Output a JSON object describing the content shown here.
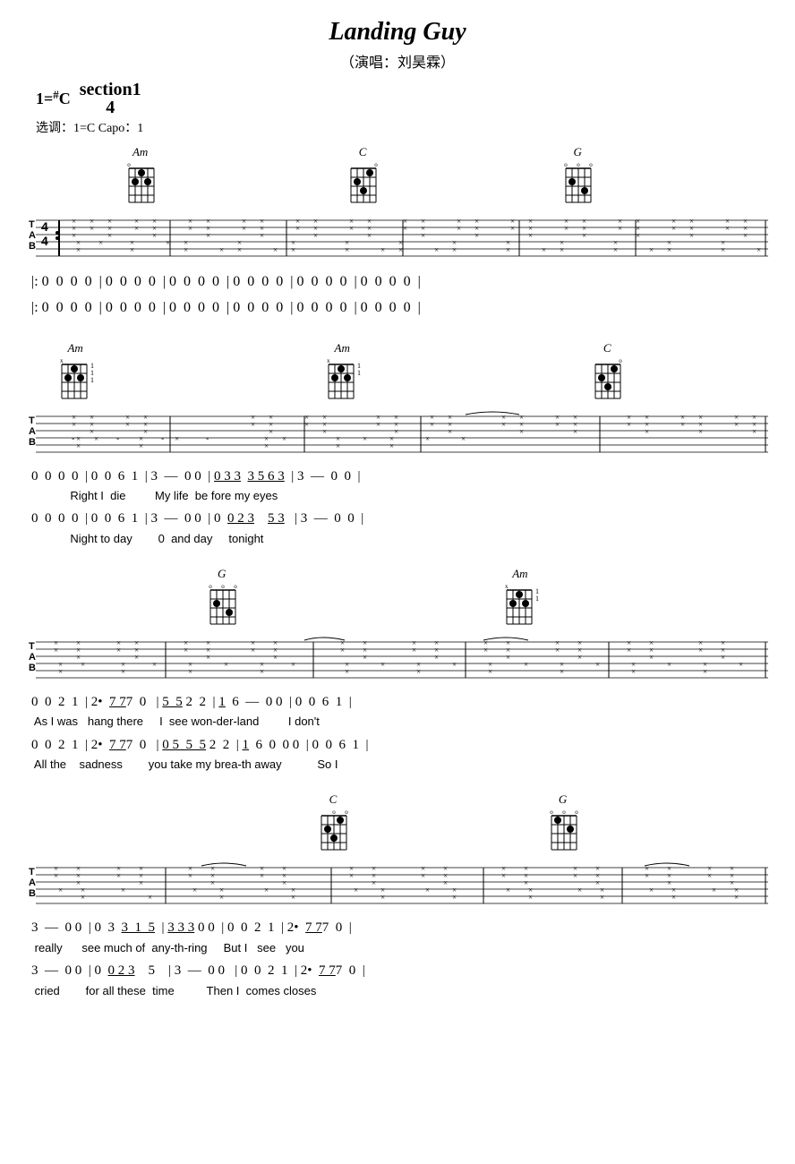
{
  "title": "Landing Guy",
  "subtitle": "（演唱：刘昊霖）",
  "key_display": "1=",
  "key_sharp": "#",
  "key_note": "C",
  "time_num": "4",
  "time_den": "4",
  "capo_line": "选调：1=C  Capo：1",
  "sections": [
    {
      "id": "section1",
      "chords": [
        {
          "name": "Am",
          "x_pct": 17,
          "fret": ""
        },
        {
          "name": "C",
          "x_pct": 47,
          "fret": ""
        },
        {
          "name": "G",
          "x_pct": 76,
          "fret": ""
        }
      ],
      "notes_lines": [
        "|: 0  0  0  0  | 0  0  0  0  | 0  0  0  0  | 0  0  0  0  | 0  0  0  0  | 0  0  0  0  |",
        "|: 0  0  0  0  | 0  0  0  0  | 0  0  0  0  | 0  0  0  0  | 0  0  0  0  | 0  0  0  0  |"
      ],
      "lyrics_lines": [
        "",
        ""
      ]
    },
    {
      "id": "section2",
      "chords": [
        {
          "name": "Am",
          "x_pct": 8,
          "fret": "x"
        },
        {
          "name": "Am",
          "x_pct": 43,
          "fret": "x"
        },
        {
          "name": "C",
          "x_pct": 79,
          "fret": ""
        }
      ],
      "notes_lines": [
        "0  0  0  0  | 0  0  6  1  | 3  —  0  0  | 0̲3̲3   3̲ 5̲ 6̲3̲  | 3  —  0  0  |",
        "0  0  0  0  | 0  0  6  1  | 3  —  0  0  | 0  0̲2̲3    5̲3̲   | 3  —  0  0  |"
      ],
      "lyrics_lines": [
        "            Right I  die          My life  be fore my eyes",
        "            Night to day         0  and day     tonight"
      ]
    },
    {
      "id": "section3",
      "chords": [
        {
          "name": "G",
          "x_pct": 28,
          "fret": ""
        },
        {
          "name": "Am",
          "x_pct": 68,
          "fret": "x"
        }
      ],
      "notes_lines": [
        "0  0  2  1  | 2•  7̲7̲7̲ 0   | 5̲  5̲ 2  2  | 1̲  6  —  0  0  | 0  0  6  1  |",
        "0  0  2  1  | 2•  7̲7̲7̲ 0   | 0̲5̲ 5̲ 5̲ 2  2  | 1̲  6  0  0  0  | 0  0  6  1  |"
      ],
      "lyrics_lines": [
        " As I was   hang there     I  see won-der-land         I don't",
        " All the    sadness        you take my brea-th away           So I"
      ]
    },
    {
      "id": "section4",
      "chords": [
        {
          "name": "C",
          "x_pct": 43,
          "fret": ""
        },
        {
          "name": "G",
          "x_pct": 74,
          "fret": ""
        }
      ],
      "notes_lines": [
        "3  —  0  0  | 0  3  3̲  1  5̲  | 3̲3̲3̲ 0  0  | 0  0  2  1  | 2•  7̲7̲7̲ 0  |",
        "3  —  0  0  | 0  0̲2̲3    5    | 3  —  0  0  | 0  0  2  1  | 2•  7̲7̲7̲ 0  |"
      ],
      "lyrics_lines": [
        " really      see much of  any-th-ring     But I   see   you",
        " cried        for all these  time          Then I  comes closes"
      ]
    }
  ]
}
